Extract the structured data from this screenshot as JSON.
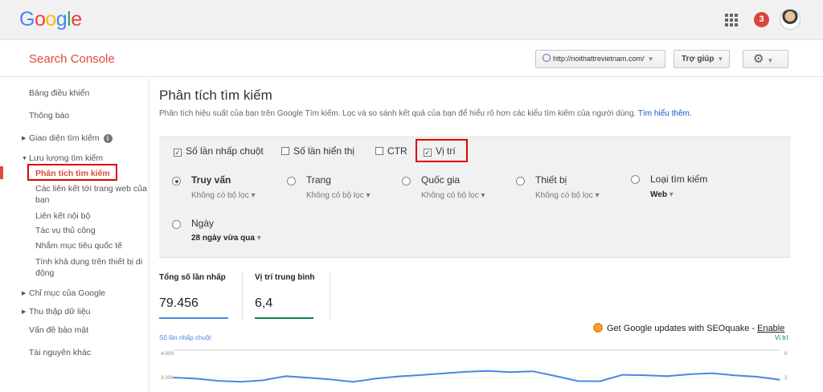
{
  "google_bar": {
    "logo": [
      "G",
      "o",
      "o",
      "g",
      "l",
      "e"
    ],
    "notification_count": "3"
  },
  "header": {
    "app_title": "Search Console",
    "site": "http://noithattrevietnam.com/",
    "help_label": "Trợ giúp"
  },
  "sidebar": {
    "items": [
      {
        "label": "Bảng điều khiển"
      },
      {
        "label": "Thông báo"
      },
      {
        "label": "Giao diện tìm kiếm"
      },
      {
        "label": "Lưu lượng tìm kiếm"
      },
      {
        "label": "Phân tích tìm kiếm"
      },
      {
        "label": "Các liên kết tới trang web của bạn"
      },
      {
        "label": "Liên kết nội bộ"
      },
      {
        "label": "Tác vụ thủ công"
      },
      {
        "label": "Nhắm mục tiêu quốc tế"
      },
      {
        "label": "Tính khả dụng trên thiết bị di động"
      },
      {
        "label": "Chỉ mục của Google"
      },
      {
        "label": "Thu thập dữ liệu"
      },
      {
        "label": "Vấn đề bảo mật"
      },
      {
        "label": "Tài nguyên khác"
      }
    ]
  },
  "page": {
    "title": "Phân tích tìm kiếm",
    "description": "Phân tích hiệu suất của bạn trên Google Tìm kiếm. Lọc và so sánh kết quả của bạn để hiểu rõ hơn các kiểu tìm kiếm của người dùng.",
    "learn_more": "Tìm hiểu thêm."
  },
  "metric_checkboxes": [
    {
      "label": "Số lần nhấp chuột",
      "checked": true
    },
    {
      "label": "Số lần hiển thị",
      "checked": false
    },
    {
      "label": "CTR",
      "checked": false
    },
    {
      "label": "Vị trí",
      "checked": true
    }
  ],
  "group_options": [
    {
      "label": "Truy vấn",
      "selected": true,
      "sub": "Không có bộ lọc"
    },
    {
      "label": "Trang",
      "selected": false,
      "sub": "Không có bộ lọc"
    },
    {
      "label": "Quốc gia",
      "selected": false,
      "sub": "Không có bộ lọc"
    },
    {
      "label": "Thiết bị",
      "selected": false,
      "sub": "Không có bộ lọc"
    },
    {
      "label": "Loại tìm kiếm",
      "selected": false,
      "sub": "Web"
    },
    {
      "label": "Ngày",
      "selected": false,
      "sub": "28 ngày vừa qua"
    }
  ],
  "metrics": {
    "clicks_label": "Tổng số lần nhấp",
    "clicks_value": "79.456",
    "clicks_color": "#4a86e8",
    "position_label": "Vị trí trung bình",
    "position_value": "6,4",
    "position_color": "#0b8043"
  },
  "seoquake": {
    "text": "Get Google updates with SEOquake - ",
    "enable": "Enable"
  },
  "chart_data": {
    "type": "line",
    "series": [
      {
        "name": "Số lần nhấp chuột",
        "axis": "left",
        "color": "#4a86e8",
        "values": [
          3000,
          2960,
          2880,
          2845,
          2900,
          3050,
          2990,
          2930,
          2840,
          2960,
          3040,
          3090,
          3150,
          3210,
          3240,
          3200,
          3230,
          3060,
          2870,
          2865,
          3100,
          3085,
          3050,
          3120,
          3160,
          3080,
          3030,
          2920
        ]
      }
    ],
    "left_axis_ticks": [
      "4.000",
      "3.000"
    ],
    "right_axis_ticks": [
      "0",
      "2"
    ],
    "left_axis_label": "Số lần nhấp chuột",
    "right_axis_label": "Vị trí",
    "ylim_left": [
      0,
      4000
    ],
    "ylim_right": [
      0,
      4
    ],
    "grid": true
  }
}
